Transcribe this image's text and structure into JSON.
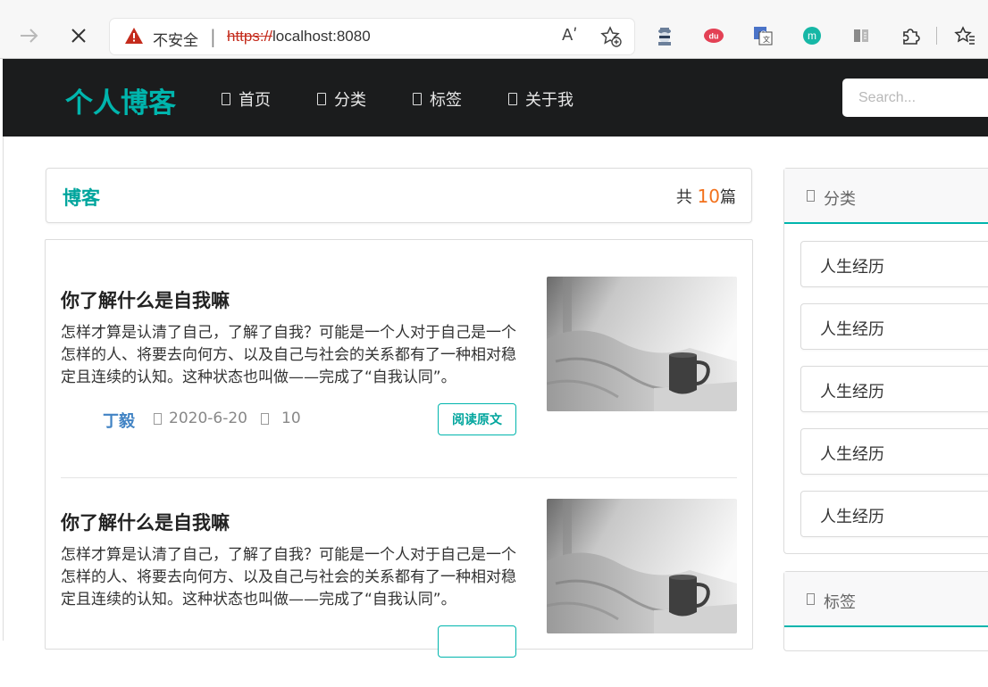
{
  "browser": {
    "security_label": "不安全",
    "separator": "|",
    "url_scheme": "https://",
    "url_host": "localhost:8080",
    "read_aloud": "Aʹ"
  },
  "header": {
    "brand": "个人博客",
    "nav": [
      {
        "label": "首页"
      },
      {
        "label": "分类"
      },
      {
        "label": "标签"
      },
      {
        "label": "关于我"
      }
    ],
    "search_placeholder": "Search..."
  },
  "blog_header": {
    "title": "博客",
    "count_prefix": "共",
    "count": "10",
    "count_suffix": "篇"
  },
  "posts": [
    {
      "title": "你了解什么是自我嘛",
      "excerpt": "怎样才算是认清了自己，了解了自我？可能是一个人对于自己是一个怎样的人、将要去向何方、以及自己与社会的关系都有了一种相对稳定且连续的认知。这种状态也叫做——完成了“自我认同”。",
      "author": "丁毅",
      "date": "2020-6-20",
      "views": "10",
      "read_label": "阅读原文"
    },
    {
      "title": "你了解什么是自我嘛",
      "excerpt": "怎样才算是认清了自己，了解了自我？可能是一个人对于自己是一个怎样的人、将要去向何方、以及自己与社会的关系都有了一种相对稳定且连续的认知。这种状态也叫做——完成了“自我认同”。",
      "author": "",
      "date": "",
      "views": "",
      "read_label": ""
    }
  ],
  "sidebar": {
    "categories_title": "分类",
    "categories": [
      "人生经历",
      "人生经历",
      "人生经历",
      "人生经历",
      "人生经历"
    ],
    "tags_title": "标签"
  },
  "colors": {
    "accent": "#00b5ad",
    "header_bg": "#1b1c1d",
    "count_highlight": "#f2711c",
    "author_link": "#4183c4"
  }
}
